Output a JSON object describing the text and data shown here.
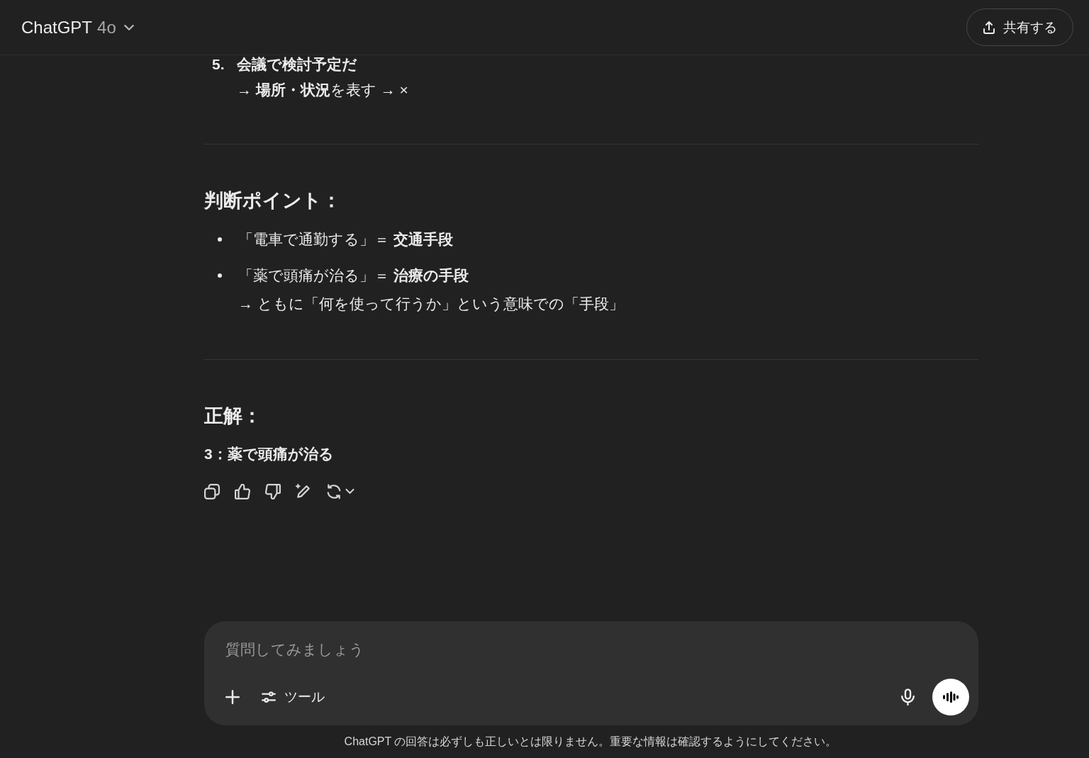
{
  "header": {
    "title": "ChatGPT",
    "model": "4o",
    "share_button": "共有する"
  },
  "conversation": {
    "numbered_list": [
      {
        "number": "5.",
        "text": "会議で検討予定だ",
        "note": "→ **場所・状況**を表す → ×"
      }
    ],
    "sections": [
      {
        "kind": "bullets",
        "heading": "判断ポイント：",
        "bullets": [
          {
            "text": "「電車で通勤する」＝ **交通手段**"
          },
          {
            "text": "「薬で頭痛が治る」＝ **治療の手段**",
            "note": "→ ともに「何を使って行うか」という意味での「手段」"
          }
        ]
      },
      {
        "kind": "answer",
        "heading": "正解：",
        "answer": "3：薬で頭痛が治る"
      }
    ]
  },
  "composer": {
    "placeholder": "質問してみましょう",
    "tools_button": "ツール"
  },
  "disclaimer": "ChatGPT の回答は必ずしも正しいとは限りません。重要な情報は確認するようにしてください。"
}
